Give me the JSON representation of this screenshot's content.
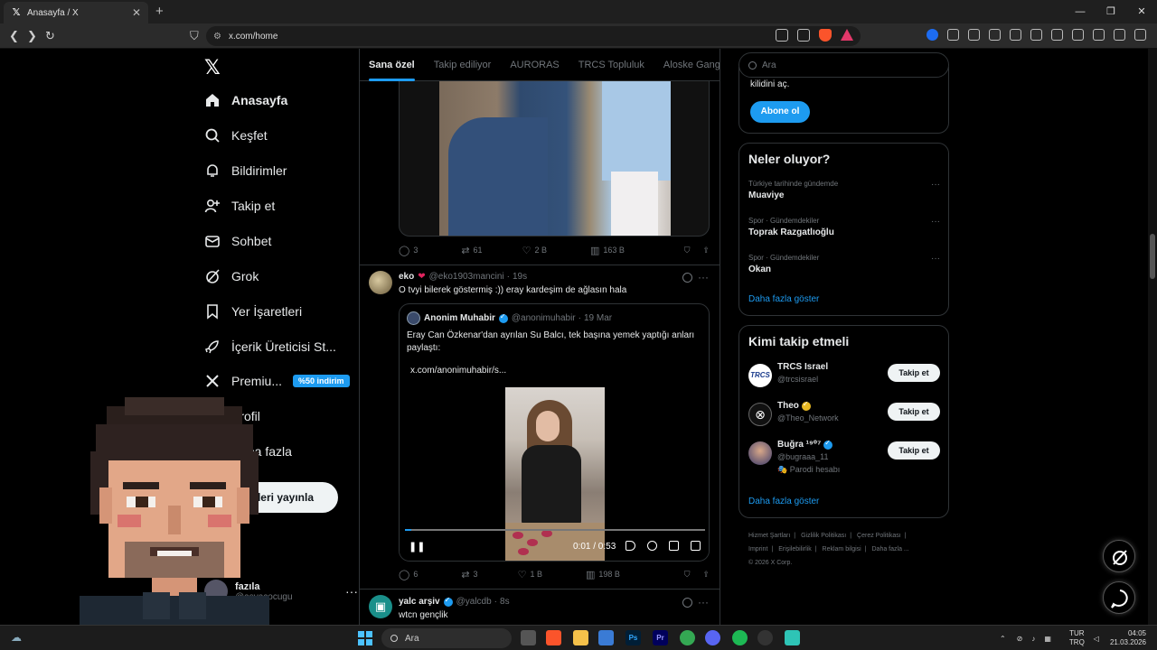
{
  "browser": {
    "tab_title": "Anasayfa / X",
    "url": "x.com/home"
  },
  "nav": {
    "items": [
      {
        "label": "Anasayfa",
        "icon": "home-icon"
      },
      {
        "label": "Keşfet",
        "icon": "search-icon"
      },
      {
        "label": "Bildirimler",
        "icon": "bell-icon"
      },
      {
        "label": "Takip et",
        "icon": "user-plus-icon"
      },
      {
        "label": "Sohbet",
        "icon": "mail-icon"
      },
      {
        "label": "Grok",
        "icon": "grok-icon"
      },
      {
        "label": "Yer İşaretleri",
        "icon": "bookmark-icon"
      },
      {
        "label": "İçerik Üreticisi St...",
        "icon": "rocket-icon"
      },
      {
        "label": "Premiu...",
        "icon": "x-icon"
      },
      {
        "label": "Profil",
        "icon": "person-icon"
      },
      {
        "label": "Daha fazla",
        "icon": "more-icon"
      }
    ],
    "premium_badge": "%50 indirim",
    "post_button": "Gönderi yayınla",
    "account": {
      "name": "fazıla",
      "handle": "@asyacocugu"
    }
  },
  "timeline": {
    "tabs": [
      "Sana özel",
      "Takip ediliyor",
      "AURORAS",
      "TRCS Topluluk",
      "Aloske Gang"
    ],
    "post0_actions": {
      "replies": "3",
      "reposts": "61",
      "likes": "2 B",
      "views": "163 B"
    },
    "post1": {
      "name": "eko",
      "handle": "@eko1903mancini",
      "time": "19s",
      "text": "O tvyi bilerek göstermiş :)) eray kardeşim de ağlasın hala",
      "quote": {
        "name": "Anonim Muhabir",
        "handle": "@anonimuhabir",
        "date": "19 Mar",
        "text": "Eray Can Özkenar'dan ayrılan Su Balcı, tek başına yemek yaptığı anları paylaştı:",
        "link": "x.com/anonimuhabir/s..."
      },
      "video": {
        "time": "0:01 / 0:53",
        "progress": 0.02
      },
      "actions": {
        "replies": "6",
        "reposts": "3",
        "likes": "1 B",
        "views": "198 B"
      }
    },
    "post2": {
      "name": "yalc arşiv",
      "handle": "@yalcdb",
      "time": "8s",
      "text": "wtcn gençlik"
    }
  },
  "sidebar": {
    "search_placeholder": "Ara",
    "premium_text": "kilidini aç.",
    "subscribe": "Abone ol",
    "trends_title": "Neler oluyor?",
    "trends": [
      {
        "context": "Türkiye tarihinde gündemde",
        "name": "Muaviye"
      },
      {
        "context": "Spor · Gündemdekiler",
        "name": "Toprak Razgatlıoğlu"
      },
      {
        "context": "Spor · Gündemdekiler",
        "name": "Okan"
      }
    ],
    "show_more": "Daha fazla göster",
    "who_title": "Kimi takip etmeli",
    "who": [
      {
        "name": "TRCS Israel",
        "handle": "@trcsisrael",
        "extra": ""
      },
      {
        "name": "Theo",
        "handle": "@Theo_Network",
        "extra": ""
      },
      {
        "name": "Buğra ¹⁹⁰⁷",
        "handle": "@bugraaa_11",
        "extra": "Parodi hesabı"
      }
    ],
    "follow_label": "Takip et",
    "footer": [
      "Hizmet Şartları",
      "|",
      "Gizlilik Politikası",
      "|",
      "Çerez Politikası",
      "|",
      "Imprint",
      "|",
      "Erişilebilirlik",
      "|",
      "Reklam bilgisi",
      "|",
      "Daha fazla ...",
      "© 2026 X Corp."
    ]
  },
  "taskbar": {
    "search": "Ara",
    "lang": [
      "TUR",
      "TRQ"
    ],
    "time": "04:05",
    "date": "21.03.2026"
  },
  "colors": {
    "accent": "#1d9bf0",
    "bg": "#000000",
    "border": "#2f3336",
    "muted": "#71767b"
  }
}
